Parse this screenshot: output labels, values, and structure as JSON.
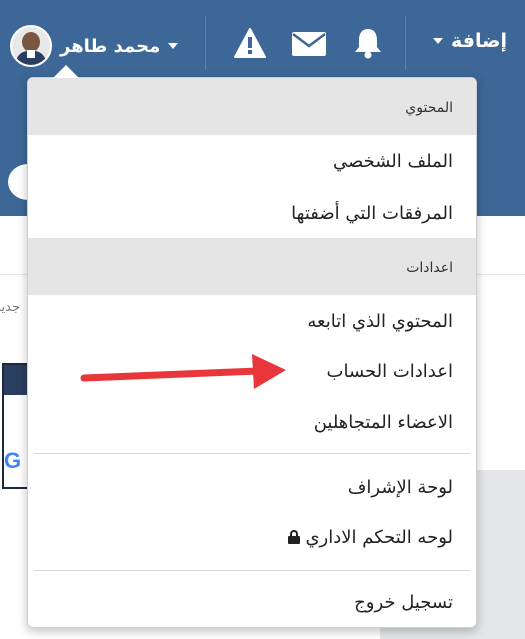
{
  "nav": {
    "user_name": "محمد طاهر",
    "add_label": "إضافة",
    "icons": [
      "warning-icon",
      "mail-icon",
      "bell-icon"
    ]
  },
  "page": {
    "side_text": "جديد",
    "google_letter": "G"
  },
  "dropdown": {
    "section_content": "المحتوي",
    "profile": "الملف الشخصي",
    "attachments": "المرفقات التي أضفتها",
    "section_settings": "اعدادات",
    "followed_content": "المحتوي الذي اتابعه",
    "account_settings": "اعدادات الحساب",
    "ignored_members": "الاعضاء المتجاهلين",
    "moderation_panel": "لوحة الإشراف",
    "admin_panel": "لوحه التحكم الاداري",
    "logout": "تسجيل خروج"
  },
  "colors": {
    "topbar": "#3c6796",
    "annotation_arrow": "#e8363a"
  }
}
